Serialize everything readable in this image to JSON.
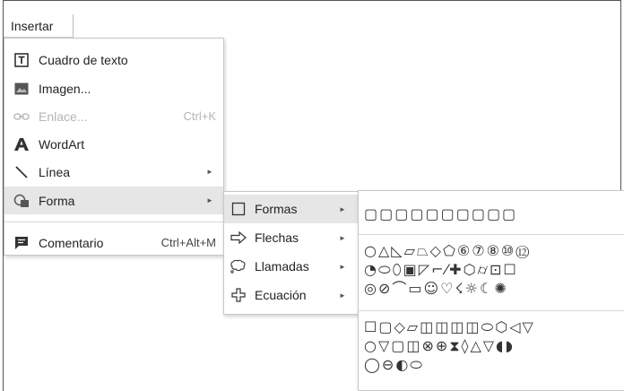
{
  "menubar": {
    "insert_label": "Insertar"
  },
  "insert_menu": {
    "items": [
      {
        "label": "Cuadro de texto",
        "icon": "text-box-icon",
        "shortcut": "",
        "submenu": false,
        "disabled": false
      },
      {
        "label": "Imagen...",
        "icon": "image-icon",
        "shortcut": "",
        "submenu": false,
        "disabled": false
      },
      {
        "label": "Enlace...",
        "icon": "link-icon",
        "shortcut": "Ctrl+K",
        "submenu": false,
        "disabled": true
      },
      {
        "label": "WordArt",
        "icon": "wordart-icon",
        "shortcut": "",
        "submenu": false,
        "disabled": false
      },
      {
        "label": "Línea",
        "icon": "line-icon",
        "shortcut": "",
        "submenu": true,
        "disabled": false
      },
      {
        "label": "Forma",
        "icon": "shape-icon",
        "shortcut": "",
        "submenu": true,
        "disabled": false,
        "highlighted": true
      },
      {
        "label": "Comentario",
        "icon": "comment-icon",
        "shortcut": "Ctrl+Alt+M",
        "submenu": false,
        "disabled": false
      }
    ]
  },
  "shape_submenu": {
    "items": [
      {
        "label": "Formas",
        "icon": "square-shape-icon",
        "highlighted": true
      },
      {
        "label": "Flechas",
        "icon": "arrow-right-icon"
      },
      {
        "label": "Llamadas",
        "icon": "callout-icon"
      },
      {
        "label": "Ecuación",
        "icon": "plus-icon"
      }
    ]
  },
  "shapes_panel": {
    "groups": [
      {
        "rows": [
          "▢▢▢▢▢▢▢▢▢▢"
        ]
      },
      {
        "rows": [
          "○△◺▱⏢◇⬠⑥⑦⑧⑩⑫",
          "◔⬭⬯▣◸⌐⁄✚⬡⌭⊡☐",
          "◎⊘⌒▭☺♡☇☼☾✺"
        ]
      },
      {
        "rows": [
          "☐▢◇▱◫◫◫◫⬭⬡◁▽",
          "○▽▢◫⊗⊕⧗◊△▽◖◗",
          "◯⊖◐⬭"
        ]
      }
    ]
  },
  "colors": {
    "highlight": "#e6e6e6",
    "disabled_text": "#b5b5b5",
    "border": "#c8c8c8"
  }
}
